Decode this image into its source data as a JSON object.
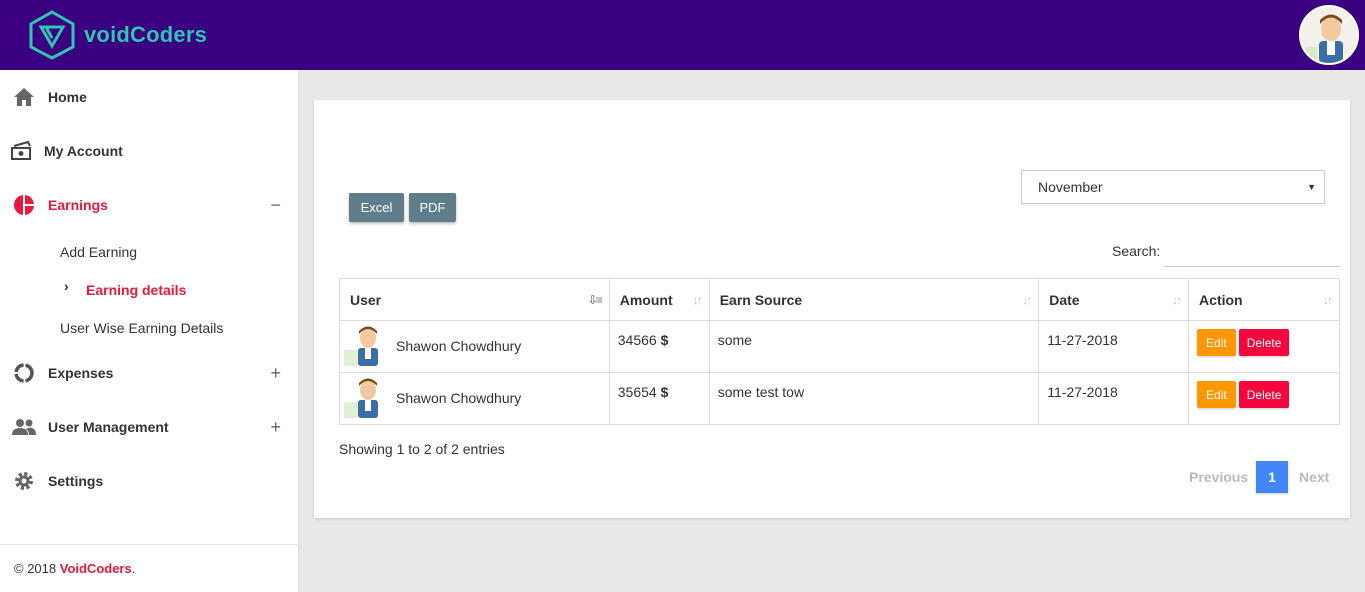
{
  "app": {
    "name": "voidCoders",
    "brand_color": "#3a0080",
    "accent_color": "#e8193c"
  },
  "sidebar": {
    "items": [
      {
        "label": "Home",
        "icon": "home-icon"
      },
      {
        "label": "My Account",
        "icon": "money-icon"
      },
      {
        "label": "Earnings",
        "icon": "pie-chart-icon",
        "toggle": "−",
        "active": true
      },
      {
        "label": "Expenses",
        "icon": "donut-chart-icon",
        "toggle": "+"
      },
      {
        "label": "User Management",
        "icon": "users-icon",
        "toggle": "+"
      },
      {
        "label": "Settings",
        "icon": "gear-icon"
      }
    ],
    "earnings_sub": [
      {
        "label": "Add Earning"
      },
      {
        "label": "Earning details",
        "active": true
      },
      {
        "label": "User Wise Earning Details"
      }
    ],
    "chevron": "›",
    "footer": {
      "prefix": "© 2018 ",
      "brand": "VoidCoders",
      "suffix": "."
    }
  },
  "toolbar": {
    "excel_label": "Excel",
    "pdf_label": "PDF",
    "month_selected": "November",
    "search_label": "Search:"
  },
  "table": {
    "headers": [
      "User",
      "Amount",
      "Earn Source",
      "Date",
      "Action"
    ],
    "rows": [
      {
        "user": "Shawon Chowdhury",
        "amount": "34566",
        "unit": "$",
        "source": "some",
        "date": "11-27-2018"
      },
      {
        "user": "Shawon Chowdhury",
        "amount": "35654",
        "unit": "$",
        "source": "some test tow",
        "date": "11-27-2018"
      }
    ],
    "edit_label": "Edit",
    "delete_label": "Delete"
  },
  "pagination": {
    "info": "Showing 1 to 2 of 2 entries",
    "prev": "Previous",
    "page": "1",
    "next": "Next"
  }
}
